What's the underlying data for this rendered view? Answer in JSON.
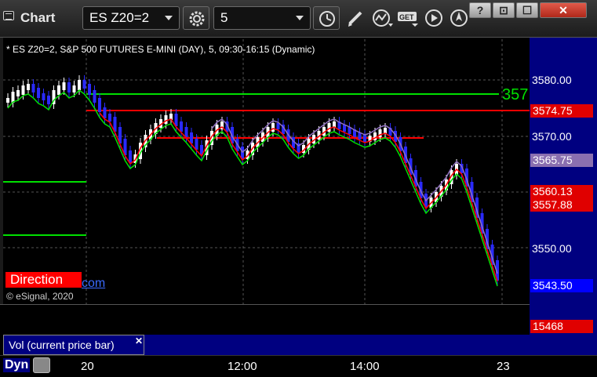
{
  "window": {
    "title": "Chart",
    "symbol": "ES Z20=2",
    "interval": "5",
    "controls": {
      "help": "?",
      "restore": "⊡",
      "maximize": "☐",
      "close": "✕"
    }
  },
  "chart": {
    "header": "* ES Z20=2, S&P 500 FUTURES E-MINI (DAY), 5, 09:30-16:15 (Dynamic)",
    "copyright": "© eSignal, 2020",
    "direction_label": "Direction",
    "link_fragment": "com",
    "overlay_value": "357",
    "price_axis": [
      "3580.00",
      "3570.00",
      "3550.00"
    ],
    "price_tags": [
      {
        "value": "3574.75",
        "color": "#e00000"
      },
      {
        "value": "3565.75",
        "color": "#8a6fb0"
      },
      {
        "value": "3560.13",
        "color": "#e00000"
      },
      {
        "value": "3557.88",
        "color": "#e00000"
      },
      {
        "value": "3543.50",
        "color": "#0000ff"
      }
    ],
    "volume_tag": {
      "value": "15468",
      "color": "#e00000"
    },
    "volume_legend": "Vol (current price bar)",
    "time_axis": [
      "20",
      "12:00",
      "14:00",
      "23"
    ],
    "bottom_mode": "Dyn",
    "colors": {
      "up_candle": "#ffffff",
      "down_candle": "#2a2aff",
      "resistance": "#ff0000",
      "support": "#00e000",
      "ema_purple": "#9070c0"
    }
  }
}
